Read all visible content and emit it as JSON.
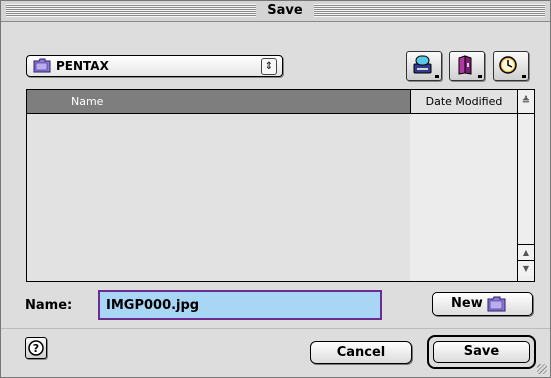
{
  "window": {
    "title": "Save"
  },
  "location": {
    "folder": "PENTAX",
    "popup_arrows": "⇕"
  },
  "toolbar": {
    "volume_icon": "disk-icon",
    "favorites_icon": "favorites-icon",
    "recent_icon": "clock-icon"
  },
  "list": {
    "columns": {
      "name": "Name",
      "date_modified": "Date Modified"
    },
    "sort_glyph": "≜",
    "scroll_up": "▲",
    "scroll_down": "▼",
    "items": []
  },
  "name_field": {
    "label": "Name:",
    "value": "IMGP000.jpg"
  },
  "buttons": {
    "new_label": "New",
    "help_label": "?",
    "cancel_label": "Cancel",
    "save_label": "Save"
  },
  "colors": {
    "selection": "#a9d6f5",
    "focus_ring": "#6b2d8f",
    "header_bg": "#7e7e7e"
  }
}
